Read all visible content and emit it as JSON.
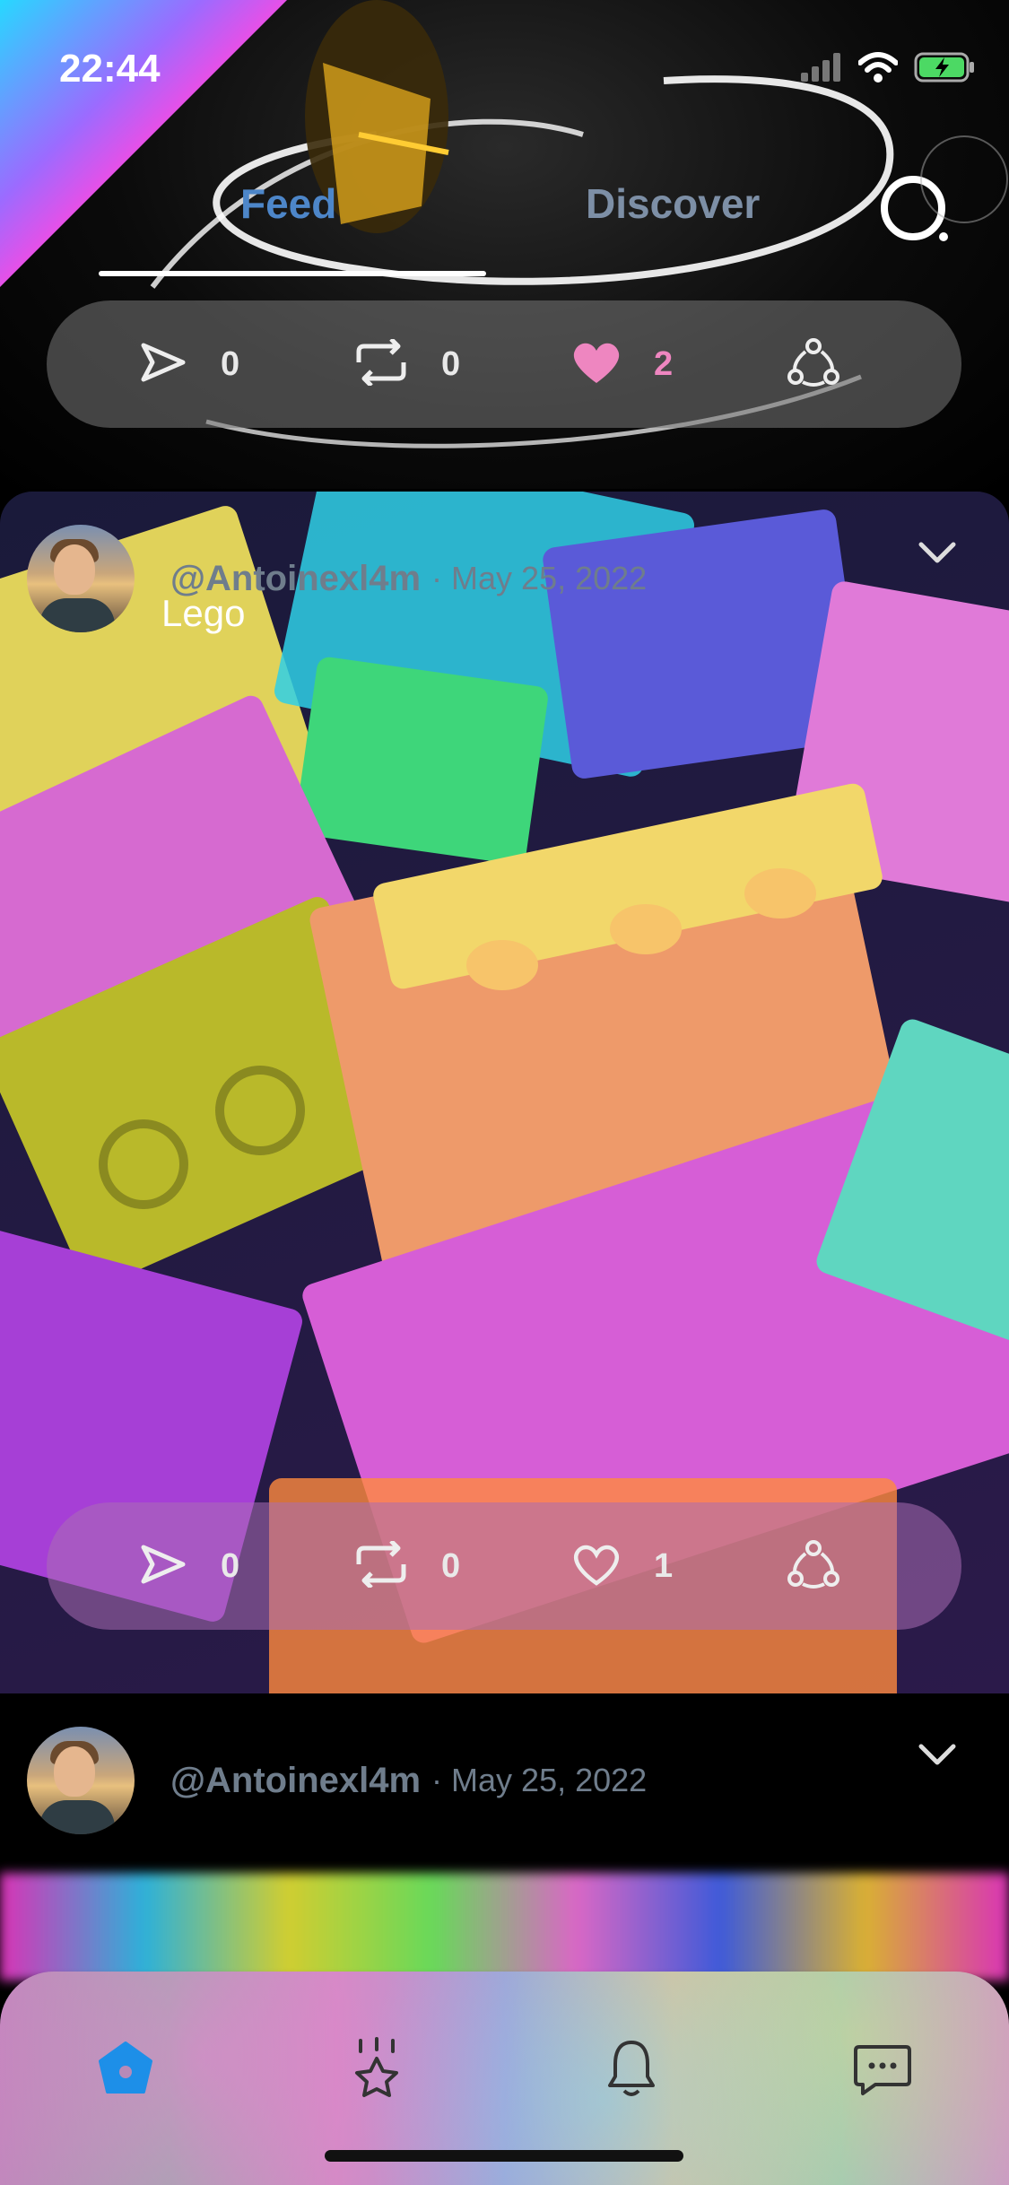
{
  "status_bar": {
    "time": "22:44",
    "icons": [
      "signal-icon",
      "wifi-icon",
      "battery-charging-icon"
    ]
  },
  "tabs": [
    {
      "label": "Feed",
      "active": true
    },
    {
      "label": "Discover",
      "active": false
    }
  ],
  "posts": [
    {
      "actions": {
        "send": "0",
        "repost": "0",
        "like": "2",
        "liked": true
      }
    },
    {
      "username": "@Antoinexl4m",
      "date": "· May 25, 2022",
      "caption": "Lego",
      "actions": {
        "send": "0",
        "repost": "0",
        "like": "1",
        "liked": false
      }
    },
    {
      "username": "@Antoinexl4m",
      "date": "· May 25, 2022"
    }
  ],
  "bottom_nav": [
    {
      "icon": "home-icon",
      "active": true
    },
    {
      "icon": "star-explore-icon",
      "active": false
    },
    {
      "icon": "bell-icon",
      "active": false
    },
    {
      "icon": "chat-icon",
      "active": false
    }
  ],
  "colors": {
    "active_tab": "#4d86c9",
    "inactive_tab": "#7d8fa6",
    "liked": "#ee86c0",
    "nav_active": "#1d8fe8"
  }
}
